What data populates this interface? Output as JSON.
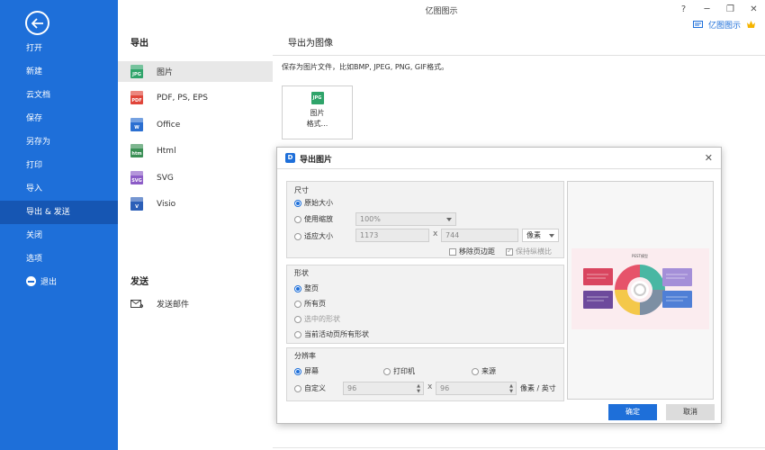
{
  "app_title": "亿图图示",
  "user_name": "亿图图示",
  "sidebar": {
    "items": [
      {
        "label": "打开"
      },
      {
        "label": "新建"
      },
      {
        "label": "云文档"
      },
      {
        "label": "保存"
      },
      {
        "label": "另存为"
      },
      {
        "label": "打印"
      },
      {
        "label": "导入"
      },
      {
        "label": "导出 & 发送",
        "active": true
      },
      {
        "label": "关闭"
      },
      {
        "label": "选项"
      },
      {
        "label": "退出"
      }
    ]
  },
  "export_panel": {
    "heading": "导出",
    "formats": [
      {
        "label": "图片",
        "icon": "JPG",
        "color": "#2fa46a",
        "active": true
      },
      {
        "label": "PDF, PS, EPS",
        "icon": "PDF",
        "color": "#e0453a"
      },
      {
        "label": "Office",
        "icon": "W",
        "color": "#2b6fd1"
      },
      {
        "label": "Html",
        "icon": "htm",
        "color": "#3a8f55"
      },
      {
        "label": "SVG",
        "icon": "SVG",
        "color": "#8c5cc7"
      },
      {
        "label": "Visio",
        "icon": "V",
        "color": "#2b5fb8"
      }
    ],
    "send_heading": "发送",
    "send_mail": "发送邮件"
  },
  "main": {
    "heading": "导出为图像",
    "description": "保存为图片文件，比如BMP, JPEG, PNG, GIF格式。",
    "card": {
      "icon": "JPG",
      "line1": "图片",
      "line2": "格式..."
    }
  },
  "dialog": {
    "title": "导出图片",
    "size": {
      "label": "尺寸",
      "original": "原始大小",
      "scale": "使用缩放",
      "scale_value": "100%",
      "fit": "适应大小",
      "width": "1173",
      "height": "744",
      "unit": "像素",
      "remove_margin": "移除页边距",
      "keep_ratio": "保持纵横比"
    },
    "shape": {
      "label": "形状",
      "whole_page": "整页",
      "all_pages": "所有页",
      "selected": "选中的形状",
      "current_active": "当前活动页所有形状"
    },
    "resolution": {
      "label": "分辨率",
      "screen": "屏幕",
      "printer": "打印机",
      "source": "来源",
      "custom": "自定义",
      "x": "96",
      "y": "96",
      "unit": "像素 / 英寸"
    },
    "preview_title": "PEST模型",
    "ok": "确定",
    "cancel": "取消"
  },
  "colors": {
    "accent": "#1e6fd9",
    "sidebar_active": "#1656b3"
  }
}
